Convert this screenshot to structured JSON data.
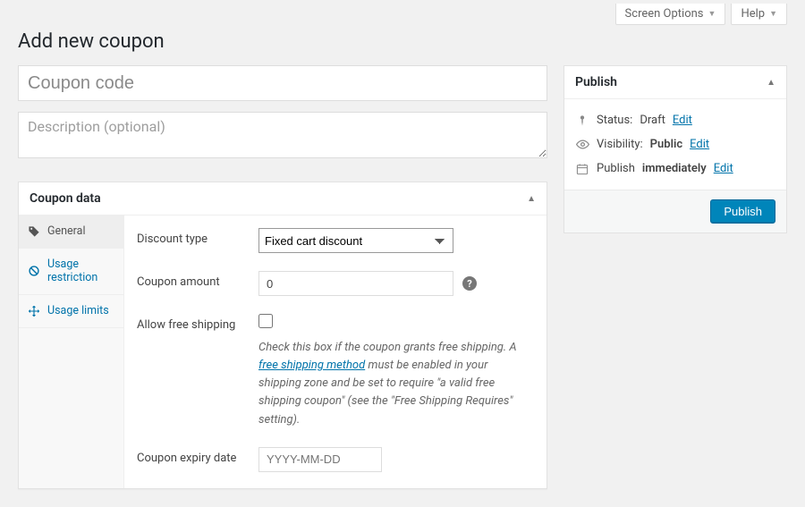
{
  "topbar": {
    "screen_options": "Screen Options",
    "help": "Help"
  },
  "page": {
    "title": "Add new coupon",
    "coupon_code_placeholder": "Coupon code",
    "coupon_code_value": "",
    "description_placeholder": "Description (optional)",
    "description_value": ""
  },
  "coupon_data": {
    "panel_title": "Coupon data",
    "tabs": {
      "general": "General",
      "usage_restriction": "Usage restriction",
      "usage_limits": "Usage limits"
    },
    "fields": {
      "discount_type_label": "Discount type",
      "discount_type_value": "Fixed cart discount",
      "coupon_amount_label": "Coupon amount",
      "coupon_amount_value": "0",
      "free_shipping_label": "Allow free shipping",
      "free_shipping_help_pre": "Check this box if the coupon grants free shipping. A ",
      "free_shipping_link": "free shipping method",
      "free_shipping_help_post": " must be enabled in your shipping zone and be set to require \"a valid free shipping coupon\" (see the \"Free Shipping Requires\" setting).",
      "expiry_label": "Coupon expiry date",
      "expiry_placeholder": "YYYY-MM-DD",
      "expiry_value": ""
    }
  },
  "publish": {
    "title": "Publish",
    "status_label": "Status:",
    "status_value": "Draft",
    "visibility_label": "Visibility:",
    "visibility_value": "Public",
    "schedule_label": "Publish",
    "schedule_value": "immediately",
    "edit": "Edit",
    "button": "Publish"
  }
}
